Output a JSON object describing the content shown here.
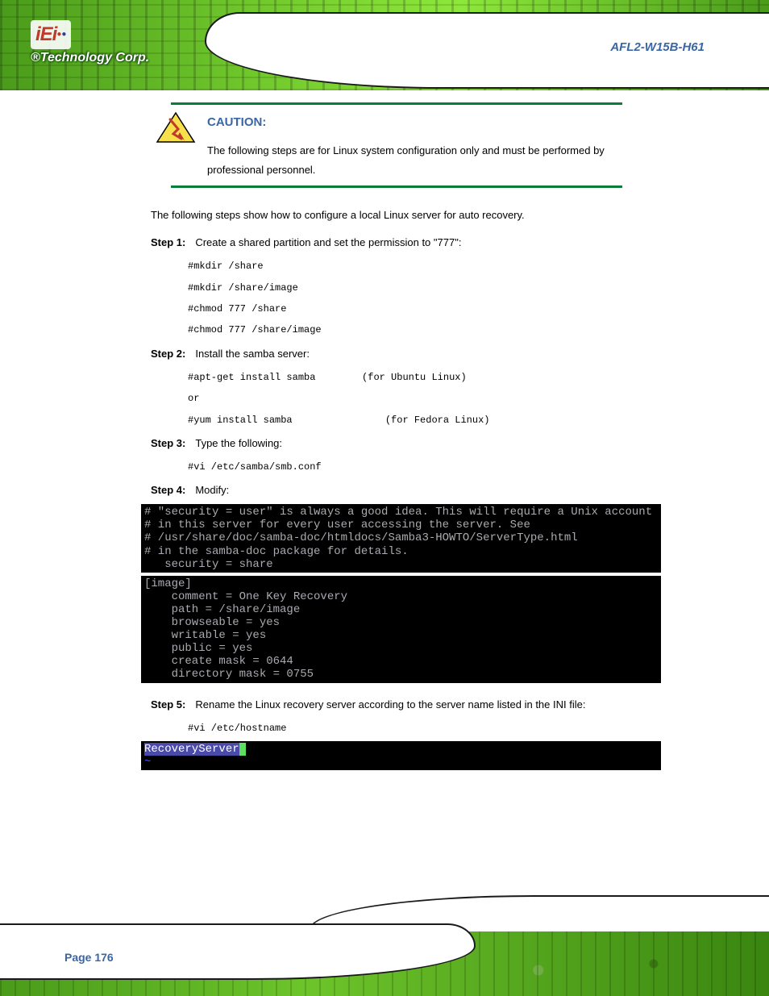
{
  "header": {
    "logo_text": "iEi",
    "tagline": "®Technology Corp.",
    "product": "AFL2-W15B-H61"
  },
  "caution": {
    "heading": "CAUTION:",
    "text": "The following steps are for Linux system configuration only and must be performed by professional personnel."
  },
  "body": {
    "intro": "The following steps show how to configure a local Linux server for auto recovery.",
    "step1_num": "Step 1:",
    "step1_text": "Create a shared partition and set the permission to \"777\":",
    "step1_cmd1": "#mkdir /share",
    "step1_cmd2": "#mkdir /share/image",
    "step1_cmd3": "#chmod 777 /share",
    "step1_cmd4": "#chmod 777 /share/image",
    "step2_num": "Step 2:",
    "step2_text": "Install the samba server:",
    "step2_cmd1": "#apt-get install samba",
    "step2_cmd2": "(for Ubuntu Linux)",
    "step2_cmd3": "or",
    "step2_cmd4": "#yum install samba",
    "step2_cmd5": "(for Fedora Linux)",
    "step3_num": "Step 3:",
    "step3_text": "Type the following:",
    "step3_cmd1": "#vi /etc/samba/smb.conf",
    "step4_num": "Step 4:",
    "step4_text": "Modify:",
    "step5_num": "Step 5:",
    "step5_text": "Rename the Linux recovery server according to the server name listed in the INI file:",
    "step5_cmd1": "#vi /etc/hostname"
  },
  "terminal1": {
    "l1": "# \"security = user\" is always a good idea. This will require a Unix account",
    "l2": "# in this server for every user accessing the server. See",
    "l3": "# /usr/share/doc/samba-doc/htmldocs/Samba3-HOWTO/ServerType.html",
    "l4": "# in the samba-doc package for details.",
    "l5": "   security = share"
  },
  "terminal2": {
    "l1": "[image]",
    "l2": "    comment = One Key Recovery",
    "l3": "    path = /share/image",
    "l4": "    browseable = yes",
    "l5": "    writable = yes",
    "l6": "    public = yes",
    "l7": "    create mask = 0644",
    "l8": "    directory mask = 0755"
  },
  "terminal3": {
    "host": "RecoveryServer",
    "cursor": " ",
    "tilde": "~"
  },
  "footer": {
    "page": "Page 176"
  }
}
